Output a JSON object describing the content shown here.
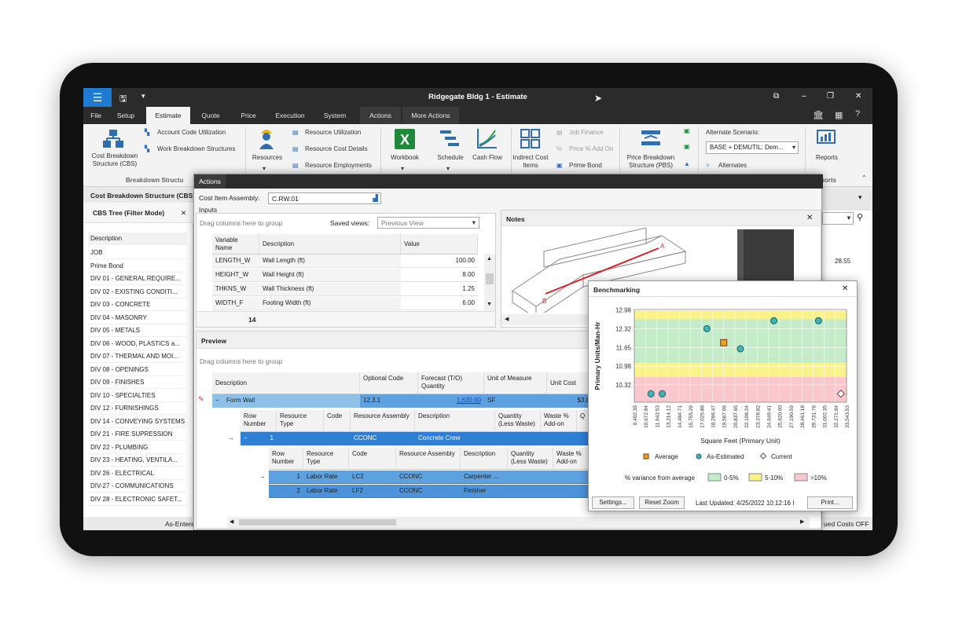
{
  "window": {
    "title": "Ridgegate Bldg 1 - Estimate"
  },
  "tabs": [
    "File",
    "Setup",
    "Estimate",
    "Quote",
    "Price",
    "Execution",
    "System",
    "Actions",
    "More Actions"
  ],
  "ribbon": {
    "cbs": "Cost Breakdown Structure (CBS)",
    "account_code": "Account Code Utilization",
    "wbs": "Work Breakdown Structures",
    "group1": "Breakdown Structu",
    "resources": "Resources",
    "res_util": "Resource Utilization",
    "res_cost": "Resource Cost Details",
    "res_emp": "Resource Employments",
    "workbook": "Workbook",
    "schedule": "Schedule",
    "cashflow": "Cash Flow",
    "indirect": "Indirect Cost Items",
    "job_finance": "Job Finance",
    "price_addon": "Price % Add On",
    "prime_bond": "Prime Bond",
    "pbs": "Price Breakdown Structure (PBS)",
    "alt_scenario_label": "Alternate Scenario:",
    "alt_scenario_value": "BASE + DEMUTIL: Dem...",
    "alternates": "Alternates",
    "reports": "Reports",
    "reports_group": "ports"
  },
  "left_panel": {
    "title": "Cost Breakdown Structure (CBS)",
    "subtitle": "CBS Tree (Filter Mode)",
    "header": "Description",
    "rows": [
      "JOB",
      "Prime Bond",
      "DIV 01 - GENERAL REQUIRE...",
      "DIV 02 - EXISTING CONDITI...",
      "DIV 03 - CONCRETE",
      "DIV 04 - MASONRY",
      "DIV 05 - METALS",
      "DIV 06 - WOOD, PLASTICS a...",
      "DIV 07 - THERMAL AND MOI...",
      "DIV 08 - OPENINGS",
      "DIV 09 - FINISHES",
      "DIV 10 - SPECIALTIES",
      "DIV 12 - FURNISHINGS",
      "DIV 14 - CONVEYING SYSTEMS",
      "DIV 21 - FIRE SUPRESSION",
      "DIV 22 - PLUMBING",
      "DIV 23 - HEATING, VENTILA...",
      "DIV 26 - ELECTRICAL",
      "DIV-27 - COMMUNICATIONS",
      "DIV 28 - ELECTRONIC SAFET..."
    ],
    "footer": "As-Entere"
  },
  "dialog": {
    "tab": "Actions",
    "assembly_label": "Cost Item Assembly:",
    "assembly_value": "C.RW.01",
    "inputs_label": "Inputs",
    "group_hint": "Drag columns here to group",
    "saved_views_label": "Saved views:",
    "saved_views_value": "Previous View",
    "inputs_headers": [
      "Variable Name",
      "Description",
      "Value"
    ],
    "inputs_rows": [
      [
        "LENGTH_W",
        "Wall Length (ft)",
        "100.00"
      ],
      [
        "HEIGHT_W",
        "Wall Height (ft)",
        "8.00"
      ],
      [
        "THKNS_W",
        "Wall Thickness (ft)",
        "1.25"
      ],
      [
        "WIDTH_F",
        "Footing Width (ft)",
        "6.00"
      ]
    ],
    "inputs_count": "14",
    "notes_label": "Notes",
    "preview_label": "Preview",
    "preview_headers": [
      "Description",
      "Optional Code",
      "Forecast (T/O) Quantity",
      "Unit of Measure",
      "Unit Cost"
    ],
    "preview_row": [
      "Form Wall",
      "12.3.1",
      "1,620.00",
      "SF",
      "$3.8"
    ],
    "lvl2_headers": [
      "Row Number",
      "Resource Type",
      "Code",
      "Resource Assembly",
      "Description",
      "Quantity (Less Waste)",
      "Waste % Add-on",
      "Q"
    ],
    "lvl2_row": [
      "1",
      "",
      "",
      "CCONC",
      "Concrete Crew"
    ],
    "lvl3_headers": [
      "Row Number",
      "Resource Type",
      "Code",
      "Resource Assembly",
      "Description",
      "Quantity (Less Waste)",
      "Waste % Add-on"
    ],
    "lvl3_rows": [
      [
        "1",
        "Labor Rate",
        "LC2",
        "CCONC",
        "Carpenter ..."
      ],
      [
        "2",
        "Labor Rate",
        "LF2",
        "CCONC",
        "Finisher"
      ]
    ]
  },
  "right_fragments": {
    "v1": "28.55",
    "status": "ued Costs OFF"
  },
  "benchmark": {
    "title": "Benchmarking",
    "settings": "Settings...",
    "reset_zoom": "Reset Zoom",
    "last_updated": "Last Updated:  4/25/2022 10:12:16 I",
    "print": "Print...",
    "legend": [
      "Average",
      "As-Estimated",
      "Current"
    ],
    "variance_label": "% variance from average",
    "bands": [
      "0-5%",
      "5-10%",
      ">10%"
    ],
    "colors": {
      "green": "#c5ecc9",
      "yellow": "#fbf38a",
      "red": "#f9c7cc"
    }
  },
  "chart_data": {
    "type": "scatter",
    "xlabel": "Square Feet (Primary Unit)",
    "ylabel": "Primary Units/Man-Hr",
    "y_ticks": [
      "12.98",
      "12.32",
      "11.65",
      "10.98",
      "10.32"
    ],
    "x_ticks": [
      "9,402.35",
      "10,672.94",
      "11,943.53",
      "13,214.12",
      "14,484.71",
      "15,755.29",
      "17,025.88",
      "18,296.47",
      "19,567.06",
      "20,837.65",
      "22,108.24",
      "23,378.82",
      "24,649.41",
      "25,920.00",
      "27,190.59",
      "28,461.18",
      "29,731.76",
      "31,002.35",
      "32,272.94",
      "33,543.53"
    ],
    "xlim": [
      9402.35,
      33543.53
    ],
    "ylim": [
      9.7,
      13.0
    ],
    "series": [
      {
        "name": "As-Estimated",
        "points": [
          [
            11300,
            10.0
          ],
          [
            12580,
            10.0
          ],
          [
            17660,
            12.32
          ],
          [
            21470,
            11.6
          ],
          [
            25280,
            12.6
          ],
          [
            30360,
            12.6
          ]
        ]
      },
      {
        "name": "Average",
        "points": [
          [
            19570,
            11.82
          ]
        ]
      },
      {
        "name": "Current",
        "points": [
          [
            32900,
            10.0
          ]
        ]
      }
    ]
  }
}
